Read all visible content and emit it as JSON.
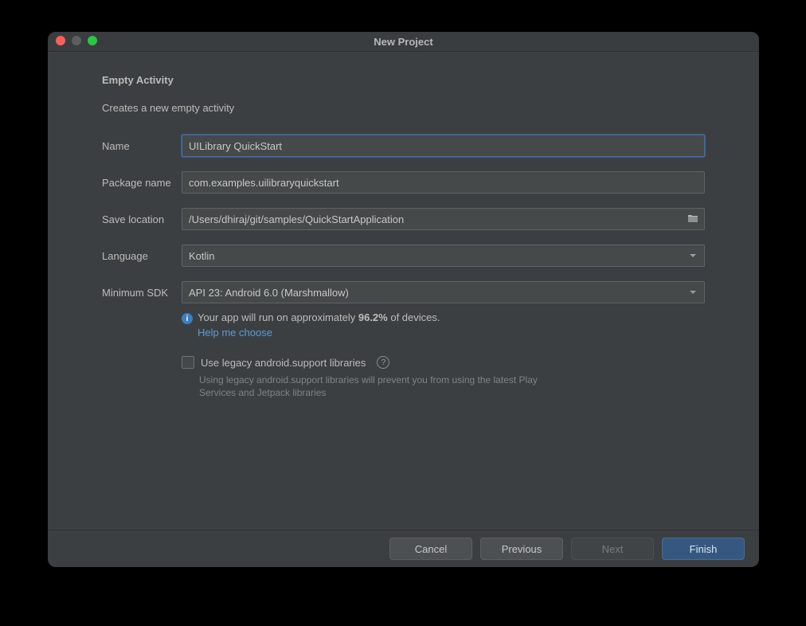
{
  "window": {
    "title": "New Project"
  },
  "header": {
    "heading": "Empty Activity",
    "subheading": "Creates a new empty activity"
  },
  "labels": {
    "name": "Name",
    "package": "Package name",
    "save": "Save location",
    "language": "Language",
    "minsdk": "Minimum SDK"
  },
  "values": {
    "name": "UILibrary QuickStart",
    "package": "com.examples.uilibraryquickstart",
    "save": "/Users/dhiraj/git/samples/QuickStartApplication",
    "language": "Kotlin",
    "minsdk": "API 23: Android 6.0 (Marshmallow)"
  },
  "info": {
    "prefix": "Your app will run on approximately ",
    "pct": "96.2%",
    "suffix": " of devices.",
    "link": "Help me choose"
  },
  "checkbox": {
    "label": "Use legacy android.support libraries",
    "hint": "Using legacy android.support libraries will prevent you from using the latest Play Services and Jetpack libraries"
  },
  "footer": {
    "cancel": "Cancel",
    "previous": "Previous",
    "next": "Next",
    "finish": "Finish"
  }
}
